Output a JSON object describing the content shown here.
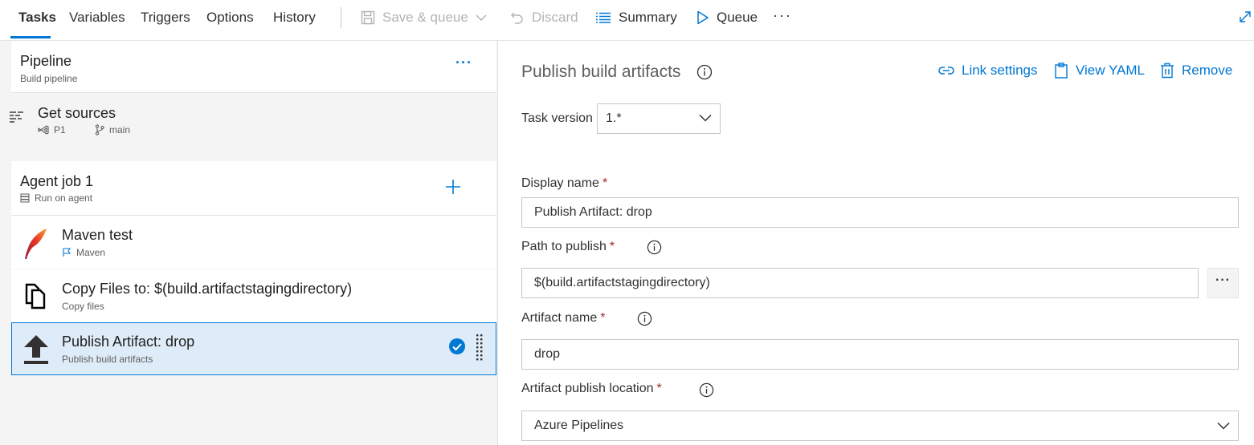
{
  "toolbar": {
    "tabs": [
      {
        "label": "Tasks",
        "active": true
      },
      {
        "label": "Variables",
        "active": false
      },
      {
        "label": "Triggers",
        "active": false
      },
      {
        "label": "Options",
        "active": false
      },
      {
        "label": "History",
        "active": false
      }
    ],
    "save_queue_label": "Save & queue",
    "discard_label": "Discard",
    "summary_label": "Summary",
    "queue_label": "Queue",
    "more_label": "···",
    "icons": [
      "save-icon",
      "chevron-down-icon",
      "undo-icon",
      "list-icon",
      "play-icon",
      "expand-icon"
    ],
    "accent_color": "#0078d4",
    "disabled_color": "#b3b3b3"
  },
  "pipeline": {
    "title": "Pipeline",
    "subtitle": "Build pipeline",
    "more_label": "···"
  },
  "get_sources": {
    "title": "Get sources",
    "project": "P1",
    "branch": "main",
    "icons": [
      "list-icon",
      "visual-studio-icon",
      "branch-icon"
    ]
  },
  "agent_job": {
    "title": "Agent job 1",
    "subtitle": "Run on agent",
    "icons": [
      "server-icon",
      "add-icon"
    ]
  },
  "tasks": [
    {
      "title": "Maven test",
      "subtitle": "Maven",
      "icon": "maven-feather-icon",
      "sub_icon": "flag-icon",
      "selected": false
    },
    {
      "title": "Copy Files to: $(build.artifactstagingdirectory)",
      "subtitle": "Copy files",
      "icon": "copy-files-icon",
      "selected": false
    },
    {
      "title": "Publish Artifact: drop",
      "subtitle": "Publish build artifacts",
      "icon": "upload-icon",
      "selected": true
    }
  ],
  "detail": {
    "title": "Publish build artifacts",
    "link_settings_label": "Link settings",
    "view_yaml_label": "View YAML",
    "remove_label": "Remove",
    "task_version_label": "Task version",
    "task_version_value": "1.*",
    "display_name_label": "Display name",
    "display_name_value": "Publish Artifact: drop",
    "path_label": "Path to publish",
    "path_value": "$(build.artifactstagingdirectory)",
    "browse_label": "···",
    "artifact_name_label": "Artifact name",
    "artifact_name_value": "drop",
    "publish_location_label": "Artifact publish location",
    "publish_location_value": "Azure Pipelines",
    "required_mark": "*",
    "required_color": "#a4262c"
  }
}
